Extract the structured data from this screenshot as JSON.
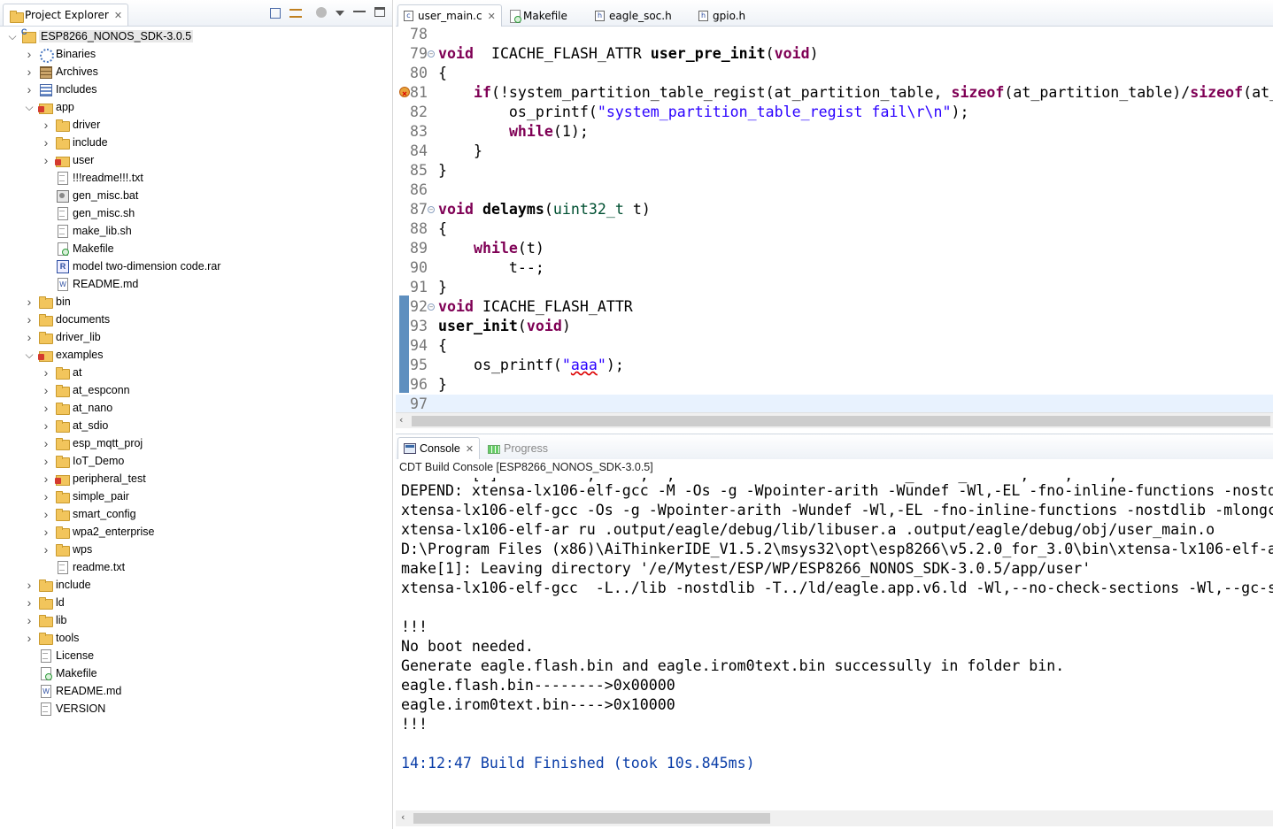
{
  "explorer": {
    "tab_label": "Project Explorer",
    "close": "✕",
    "tree": [
      {
        "label": "ESP8266_NONOS_SDK-3.0.5",
        "depth": 0,
        "arrow": "expanded",
        "icon": "project",
        "selected": true
      },
      {
        "label": "Binaries",
        "depth": 1,
        "arrow": "collapsed",
        "icon": "binaries"
      },
      {
        "label": "Archives",
        "depth": 1,
        "arrow": "collapsed",
        "icon": "archives"
      },
      {
        "label": "Includes",
        "depth": 1,
        "arrow": "collapsed",
        "icon": "includes"
      },
      {
        "label": "app",
        "depth": 1,
        "arrow": "expanded",
        "icon": "folder-red"
      },
      {
        "label": "driver",
        "depth": 2,
        "arrow": "collapsed",
        "icon": "folder"
      },
      {
        "label": "include",
        "depth": 2,
        "arrow": "collapsed",
        "icon": "folder"
      },
      {
        "label": "user",
        "depth": 2,
        "arrow": "collapsed",
        "icon": "folder-red"
      },
      {
        "label": "!!!readme!!!.txt",
        "depth": 2,
        "arrow": "none",
        "icon": "file"
      },
      {
        "label": "gen_misc.bat",
        "depth": 2,
        "arrow": "none",
        "icon": "bat"
      },
      {
        "label": "gen_misc.sh",
        "depth": 2,
        "arrow": "none",
        "icon": "file"
      },
      {
        "label": "make_lib.sh",
        "depth": 2,
        "arrow": "none",
        "icon": "file"
      },
      {
        "label": "Makefile",
        "depth": 2,
        "arrow": "none",
        "icon": "makefile"
      },
      {
        "label": "model two-dimension code.rar",
        "depth": 2,
        "arrow": "none",
        "icon": "rar"
      },
      {
        "label": "README.md",
        "depth": 2,
        "arrow": "none",
        "icon": "md"
      },
      {
        "label": "bin",
        "depth": 1,
        "arrow": "collapsed",
        "icon": "folder"
      },
      {
        "label": "documents",
        "depth": 1,
        "arrow": "collapsed",
        "icon": "folder"
      },
      {
        "label": "driver_lib",
        "depth": 1,
        "arrow": "collapsed",
        "icon": "folder"
      },
      {
        "label": "examples",
        "depth": 1,
        "arrow": "expanded",
        "icon": "folder-red"
      },
      {
        "label": "at",
        "depth": 2,
        "arrow": "collapsed",
        "icon": "folder"
      },
      {
        "label": "at_espconn",
        "depth": 2,
        "arrow": "collapsed",
        "icon": "folder"
      },
      {
        "label": "at_nano",
        "depth": 2,
        "arrow": "collapsed",
        "icon": "folder"
      },
      {
        "label": "at_sdio",
        "depth": 2,
        "arrow": "collapsed",
        "icon": "folder"
      },
      {
        "label": "esp_mqtt_proj",
        "depth": 2,
        "arrow": "collapsed",
        "icon": "folder"
      },
      {
        "label": "IoT_Demo",
        "depth": 2,
        "arrow": "collapsed",
        "icon": "folder"
      },
      {
        "label": "peripheral_test",
        "depth": 2,
        "arrow": "collapsed",
        "icon": "folder-red"
      },
      {
        "label": "simple_pair",
        "depth": 2,
        "arrow": "collapsed",
        "icon": "folder"
      },
      {
        "label": "smart_config",
        "depth": 2,
        "arrow": "collapsed",
        "icon": "folder"
      },
      {
        "label": "wpa2_enterprise",
        "depth": 2,
        "arrow": "collapsed",
        "icon": "folder"
      },
      {
        "label": "wps",
        "depth": 2,
        "arrow": "collapsed",
        "icon": "folder"
      },
      {
        "label": "readme.txt",
        "depth": 2,
        "arrow": "none",
        "icon": "file"
      },
      {
        "label": "include",
        "depth": 1,
        "arrow": "collapsed",
        "icon": "folder"
      },
      {
        "label": "ld",
        "depth": 1,
        "arrow": "collapsed",
        "icon": "folder"
      },
      {
        "label": "lib",
        "depth": 1,
        "arrow": "collapsed",
        "icon": "folder"
      },
      {
        "label": "tools",
        "depth": 1,
        "arrow": "collapsed",
        "icon": "folder"
      },
      {
        "label": "License",
        "depth": 1,
        "arrow": "none",
        "icon": "file"
      },
      {
        "label": "Makefile",
        "depth": 1,
        "arrow": "none",
        "icon": "makefile"
      },
      {
        "label": "README.md",
        "depth": 1,
        "arrow": "none",
        "icon": "md"
      },
      {
        "label": "VERSION",
        "depth": 1,
        "arrow": "none",
        "icon": "file"
      }
    ]
  },
  "editor": {
    "tabs": [
      {
        "label": "user_main.c",
        "icon": "c-file-icon",
        "active": true,
        "close": "✕"
      },
      {
        "label": "Makefile",
        "icon": "makefile-icon",
        "active": false
      },
      {
        "label": "eagle_soc.h",
        "icon": "h-file-icon",
        "active": false
      },
      {
        "label": "gpio.h",
        "icon": "h-file-icon",
        "active": false
      }
    ],
    "lines": [
      {
        "num": "78",
        "tokens": []
      },
      {
        "num": "79",
        "fold": true,
        "tokens": [
          [
            "kw",
            "void"
          ],
          [
            "",
            "  ICACHE_FLASH_ATTR "
          ],
          [
            "fn",
            "user_pre_init"
          ],
          [
            "",
            "("
          ],
          [
            "kw",
            "void"
          ],
          [
            "",
            ")"
          ]
        ]
      },
      {
        "num": "80",
        "tokens": [
          [
            "",
            "{"
          ]
        ]
      },
      {
        "num": "81",
        "marker": "error",
        "tokens": [
          [
            "",
            "    "
          ],
          [
            "kw",
            "if"
          ],
          [
            "",
            "(!system_partition_table_regist(at_partition_table, "
          ],
          [
            "kw",
            "sizeof"
          ],
          [
            "",
            "(at_partition_table)/"
          ],
          [
            "kw",
            "sizeof"
          ],
          [
            "",
            "(at_"
          ]
        ]
      },
      {
        "num": "82",
        "tokens": [
          [
            "",
            "        os_printf("
          ],
          [
            "str",
            "\"system_partition_table_regist fail\\r\\n\""
          ],
          [
            "",
            ");"
          ]
        ]
      },
      {
        "num": "83",
        "tokens": [
          [
            "",
            "        "
          ],
          [
            "kw",
            "while"
          ],
          [
            "",
            "(1);"
          ]
        ]
      },
      {
        "num": "84",
        "tokens": [
          [
            "",
            "    }"
          ]
        ]
      },
      {
        "num": "85",
        "tokens": [
          [
            "",
            "}"
          ]
        ]
      },
      {
        "num": "86",
        "tokens": []
      },
      {
        "num": "87",
        "fold": true,
        "tokens": [
          [
            "kw",
            "void"
          ],
          [
            "fn",
            " delayms"
          ],
          [
            "",
            "("
          ],
          [
            "typ",
            "uint32_t"
          ],
          [
            "",
            " t)"
          ]
        ]
      },
      {
        "num": "88",
        "tokens": [
          [
            "",
            "{"
          ]
        ]
      },
      {
        "num": "89",
        "tokens": [
          [
            "",
            "    "
          ],
          [
            "kw",
            "while"
          ],
          [
            "",
            "(t)"
          ]
        ]
      },
      {
        "num": "90",
        "tokens": [
          [
            "",
            "        t--;"
          ]
        ]
      },
      {
        "num": "91",
        "tokens": [
          [
            "",
            "}"
          ]
        ]
      },
      {
        "num": "92",
        "fold": true,
        "tokens": [
          [
            "kw",
            "void"
          ],
          [
            "",
            " ICACHE_FLASH_ATTR"
          ]
        ]
      },
      {
        "num": "93",
        "tokens": [
          [
            "fn",
            "user_init"
          ],
          [
            "",
            "("
          ],
          [
            "kw",
            "void"
          ],
          [
            "",
            ")"
          ]
        ]
      },
      {
        "num": "94",
        "tokens": [
          [
            "",
            "{"
          ]
        ]
      },
      {
        "num": "95",
        "tokens": [
          [
            "",
            "    os_printf("
          ],
          [
            "str",
            "\""
          ],
          [
            "str-err",
            "aaa"
          ],
          [
            "str",
            "\""
          ],
          [
            "",
            ");"
          ]
        ]
      },
      {
        "num": "96",
        "tokens": [
          [
            "",
            "}"
          ]
        ]
      },
      {
        "num": "97",
        "current": true,
        "tokens": []
      }
    ]
  },
  "console": {
    "tabs": [
      {
        "label": "Console",
        "active": true,
        "close": "✕"
      },
      {
        "label": "Progress",
        "active": false
      }
    ],
    "title": "CDT Build Console [ESP8266_NONOS_SDK-3.0.5]",
    "clipped_line": "        [ ]          ,     ,  ,                          _     _      ,    ,    ,",
    "lines": [
      {
        "text": "DEPEND: xtensa-lx106-elf-gcc -M -Os -g -Wpointer-arith -Wundef -Wl,-EL -fno-inline-functions -nostd",
        "style": "normal"
      },
      {
        "text": "xtensa-lx106-elf-gcc -Os -g -Wpointer-arith -Wundef -Wl,-EL -fno-inline-functions -nostdlib -mlongc",
        "style": "normal"
      },
      {
        "text": "xtensa-lx106-elf-ar ru .output/eagle/debug/lib/libuser.a .output/eagle/debug/obj/user_main.o",
        "style": "normal"
      },
      {
        "text": "D:\\Program Files (x86)\\AiThinkerIDE_V1.5.2\\msys32\\opt\\esp8266\\v5.2.0_for_3.0\\bin\\xtensa-lx106-elf-a",
        "style": "normal"
      },
      {
        "text": "make[1]: Leaving directory '/e/Mytest/ESP/WP/ESP8266_NONOS_SDK-3.0.5/app/user'",
        "style": "normal"
      },
      {
        "text": "xtensa-lx106-elf-gcc  -L../lib -nostdlib -T../ld/eagle.app.v6.ld -Wl,--no-check-sections -Wl,--gc-s",
        "style": "normal"
      },
      {
        "text": "",
        "style": "normal"
      },
      {
        "text": "!!!",
        "style": "normal"
      },
      {
        "text": "No boot needed.",
        "style": "normal"
      },
      {
        "text": "Generate eagle.flash.bin and eagle.irom0text.bin successully in folder bin.",
        "style": "normal"
      },
      {
        "text": "eagle.flash.bin-------->0x00000",
        "style": "normal"
      },
      {
        "text": "eagle.irom0text.bin---->0x10000",
        "style": "normal"
      },
      {
        "text": "!!!",
        "style": "normal"
      },
      {
        "text": "",
        "style": "normal"
      },
      {
        "text": "14:12:47 Build Finished (took 10s.845ms)",
        "style": "blue"
      }
    ]
  },
  "scroll": {
    "left_arrow": "‹"
  }
}
